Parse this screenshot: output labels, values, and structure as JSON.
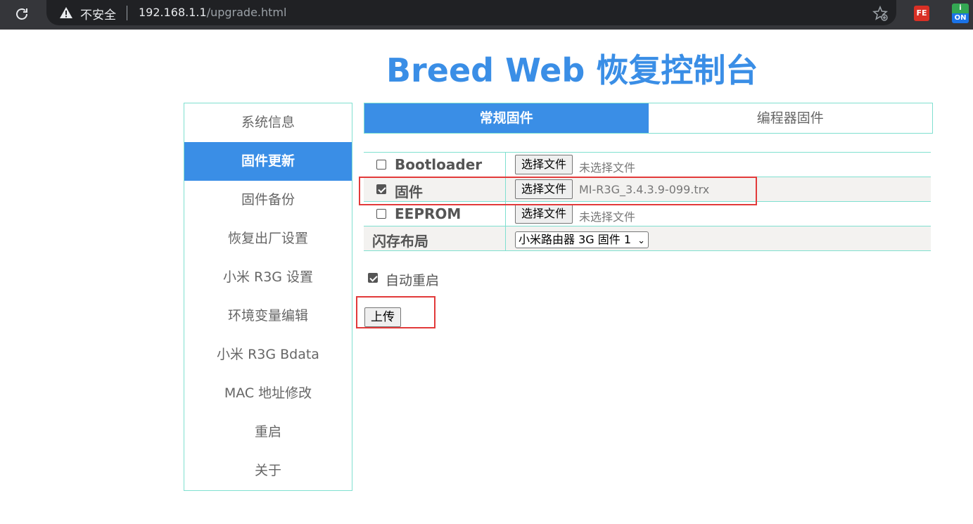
{
  "browser": {
    "security_label": "不安全",
    "url_host": "192.168.1.1",
    "url_path": "/upgrade.html",
    "ext_fe_label": "FE",
    "ext_on_label": "ON"
  },
  "page": {
    "title": "Breed Web 恢复控制台"
  },
  "sidebar": {
    "items": [
      {
        "label": "系统信息"
      },
      {
        "label": "固件更新"
      },
      {
        "label": "固件备份"
      },
      {
        "label": "恢复出厂设置"
      },
      {
        "label": "小米 R3G 设置"
      },
      {
        "label": "环境变量编辑"
      },
      {
        "label": "小米 R3G Bdata"
      },
      {
        "label": "MAC 地址修改"
      },
      {
        "label": "重启"
      },
      {
        "label": "关于"
      }
    ],
    "active_index": 1
  },
  "tabs": [
    {
      "label": "常规固件",
      "active": true
    },
    {
      "label": "编程器固件",
      "active": false
    }
  ],
  "firmware": {
    "choose_file_label": "选择文件",
    "rows": [
      {
        "label": "Bootloader",
        "checked": false,
        "file": "未选择文件"
      },
      {
        "label": "固件",
        "checked": true,
        "file": "MI-R3G_3.4.3.9-099.trx"
      },
      {
        "label": "EEPROM",
        "checked": false,
        "file": "未选择文件"
      }
    ],
    "flash_layout_label": "闪存布局",
    "flash_layout_value": "小米路由器 3G 固件 1"
  },
  "auto_reboot": {
    "label": "自动重启",
    "checked": true
  },
  "upload_label": "上传",
  "colors": {
    "accent": "#3a8ee6",
    "border": "#7fe0d0",
    "highlight": "#e23a3a"
  }
}
